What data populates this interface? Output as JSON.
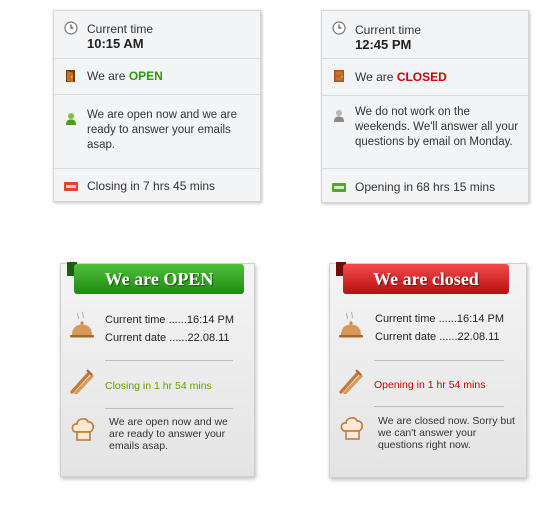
{
  "w1_open": {
    "label_time": "Current time",
    "time": "10:15 AM",
    "status_prefix": "We are",
    "status": "OPEN",
    "message": "We are open now and we are ready to answer your emails asap.",
    "countdown": "Closing in 7 hrs 45 mins"
  },
  "w1_closed": {
    "label_time": "Current time",
    "time": "12:45 PM",
    "status_prefix": "We are",
    "status": "CLOSED",
    "message": "We do not work on the weekends. We'll answer all your questions by email on Monday.",
    "countdown": "Opening in 68 hrs 15 mins"
  },
  "w2_open": {
    "ribbon": "We are OPEN",
    "time_label": "Current time ......16:14 PM",
    "date_label": "Current date ......22.08.11",
    "countdown": "Closing in 1 hr 54 mins",
    "message": "We are open now and we are ready to answer your emails asap."
  },
  "w2_closed": {
    "ribbon": "We are closed",
    "time_label": "Current time ......16:14 PM",
    "date_label": "Current date ......22.08.11",
    "countdown": "Opening in 1 hr 54 mins",
    "message": "We are closed now. Sorry but we can't answer your questions right now."
  },
  "colors": {
    "open": "#2e9a00",
    "closed": "#cc0000",
    "countdown_open": "#6b9a00"
  }
}
